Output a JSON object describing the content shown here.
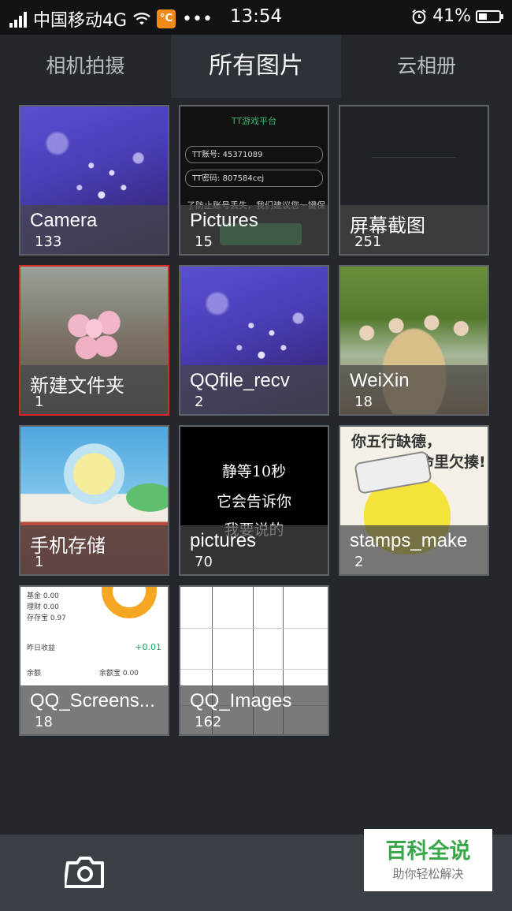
{
  "status_bar": {
    "carrier": "中国移动4G",
    "app_icon_label": "°C",
    "more": "•••",
    "time": "13:54",
    "battery": "41%",
    "battery_level": 0.41
  },
  "tabs": [
    {
      "label": "相机拍摄",
      "active": false
    },
    {
      "label": "所有图片",
      "active": true
    },
    {
      "label": "云相册",
      "active": false
    }
  ],
  "albums": [
    {
      "name": "Camera",
      "count": "133",
      "thumb": "purple-flowers"
    },
    {
      "name": "Pictures",
      "count": "15",
      "thumb": "tt-login-screen",
      "thumb_text": {
        "logo": "TT游戏平台",
        "account": "TT账号: 45371089",
        "password": "TT密码: 807584cej",
        "hint": "了防止账号丢失，我们建议您一键保",
        "button": "一键保存"
      }
    },
    {
      "name": "屏幕截图",
      "count": "251",
      "thumb": "dark-screen"
    },
    {
      "name": "新建文件夹",
      "count": "1",
      "thumb": "pink-blossom",
      "selected": true
    },
    {
      "name": "QQfile_recv",
      "count": "2",
      "thumb": "purple-flowers"
    },
    {
      "name": "WeiXin",
      "count": "18",
      "thumb": "group-photo"
    },
    {
      "name": "手机存储",
      "count": "1",
      "thumb": "campus-illustration"
    },
    {
      "name": "pictures",
      "count": "70",
      "thumb": "black-text",
      "thumb_text": [
        "静等10秒",
        "它会告诉你",
        "我要说的"
      ]
    },
    {
      "name": "stamps_make",
      "count": "2",
      "thumb": "meme",
      "thumb_text": [
        "你五行缺德，",
        "命里欠揍!"
      ]
    },
    {
      "name": "QQ_Screens...",
      "count": "18",
      "thumb": "finance-screenshot",
      "thumb_text": {
        "r1": "基金 0.00",
        "r2": "理财 0.00",
        "r3": "存存宝 0.97",
        "r4": "昨日收益",
        "pos": "+0.01",
        "r5": "余额",
        "r6": "余额宝 0.00"
      }
    },
    {
      "name": "QQ_Images",
      "count": "162",
      "thumb": "table-document"
    }
  ],
  "bottom_bar": {
    "camera_icon": "camera-icon"
  },
  "watermark": {
    "title": "百科全说",
    "subtitle": "助你轻松解决"
  },
  "colors": {
    "background": "#24282c",
    "selected_border": "#d62a2a",
    "watermark_green": "#3aa64a"
  }
}
